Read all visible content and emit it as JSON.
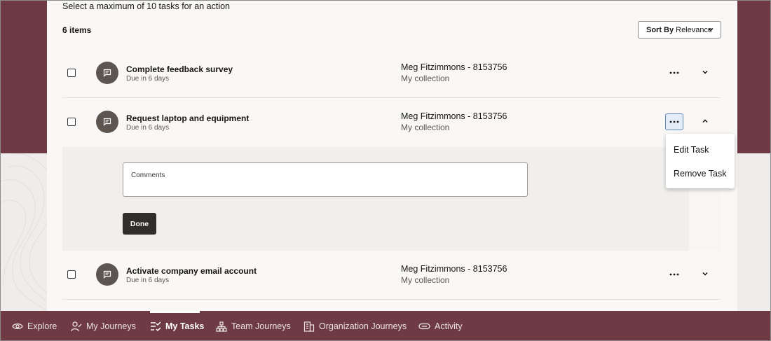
{
  "hint": "Select a maximum of 10 tasks for an action",
  "item_count": "6 items",
  "sort": {
    "label": "Sort By",
    "value": "Relevance"
  },
  "tasks": [
    {
      "title": "Complete feedback survey",
      "due": "Due in 6 days",
      "assignee": "Meg Fitzimmons - 8153756",
      "collection": "My collection"
    },
    {
      "title": "Request laptop and equipment",
      "due": "Due in 6 days",
      "assignee": "Meg Fitzimmons - 8153756",
      "collection": "My collection"
    },
    {
      "title": "Activate company email account",
      "due": "Due in 6 days",
      "assignee": "Meg Fitzimmons - 8153756",
      "collection": "My collection"
    }
  ],
  "expanded": {
    "comments_label": "Comments",
    "done_label": "Done"
  },
  "menu": {
    "edit": "Edit Task",
    "remove": "Remove Task"
  },
  "nav": [
    {
      "label": "Explore",
      "icon": "eye-icon"
    },
    {
      "label": "My Journeys",
      "icon": "person-path-icon"
    },
    {
      "label": "My Tasks",
      "icon": "checklist-icon",
      "active": true
    },
    {
      "label": "Team Journeys",
      "icon": "org-chart-icon"
    },
    {
      "label": "Organization Journeys",
      "icon": "building-icon"
    },
    {
      "label": "Activity",
      "icon": "link-icon"
    }
  ],
  "colors": {
    "brand": "#6e3a43",
    "button_dark": "#312d2a",
    "avatar": "#5c5550",
    "focus": "#5d88b8"
  }
}
